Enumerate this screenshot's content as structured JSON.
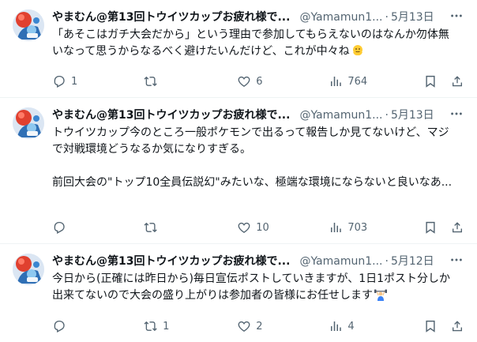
{
  "tweets": [
    {
      "author": "やまむん@第13回トウイツカップお疲れ様で...",
      "handle": "@Yamamun1...",
      "separator": "·",
      "date": "5月13日",
      "lines": [
        "「あそこはガチ大会だから」という理由で参加してもらえないのはなんか勿体無いなって思うからなるべく避けたいんだけど、これが中々ね"
      ],
      "trailing_emoji": "melting-face-emoji",
      "replies": "1",
      "retweets": "",
      "likes": "6",
      "views": "764"
    },
    {
      "author": "やまむん@第13回トウイツカップお疲れ様で...",
      "handle": "@Yamamun1...",
      "separator": "·",
      "date": "5月13日",
      "lines": [
        "トウイツカップ今のところ一般ポケモンで出るって報告しか見てないけど、マジで対戦環境どうなるか気になりすぎる。",
        "前回大会の\"トップ10全員伝説幻\"みたいな、極端な環境にならないと良いなあ..."
      ],
      "trailing_emoji": "",
      "replies": "",
      "retweets": "",
      "likes": "10",
      "views": "703"
    },
    {
      "author": "やまむん@第13回トウイツカップお疲れ様で...",
      "handle": "@Yamamun1...",
      "separator": "·",
      "date": "5月12日",
      "lines": [
        "今日から(正確には昨日から)毎日宣伝ポストしていきますが、1日1ポスト分しか出来てないので大会の盛り上がりは参加者の皆様にお任せします"
      ],
      "trailing_emoji": "person-lifting-weights-emoji",
      "replies": "",
      "retweets": "1",
      "likes": "2",
      "views": "4"
    }
  ],
  "icons": {
    "avatar": "avatar-image",
    "more": "more-icon",
    "reply": "reply-icon",
    "retweet": "retweet-icon",
    "like": "heart-icon",
    "views": "views-icon",
    "bookmark": "bookmark-icon",
    "share": "share-icon"
  },
  "colors": {
    "text": "#0f1419",
    "secondary": "#536471",
    "divider": "#eff3f4"
  }
}
